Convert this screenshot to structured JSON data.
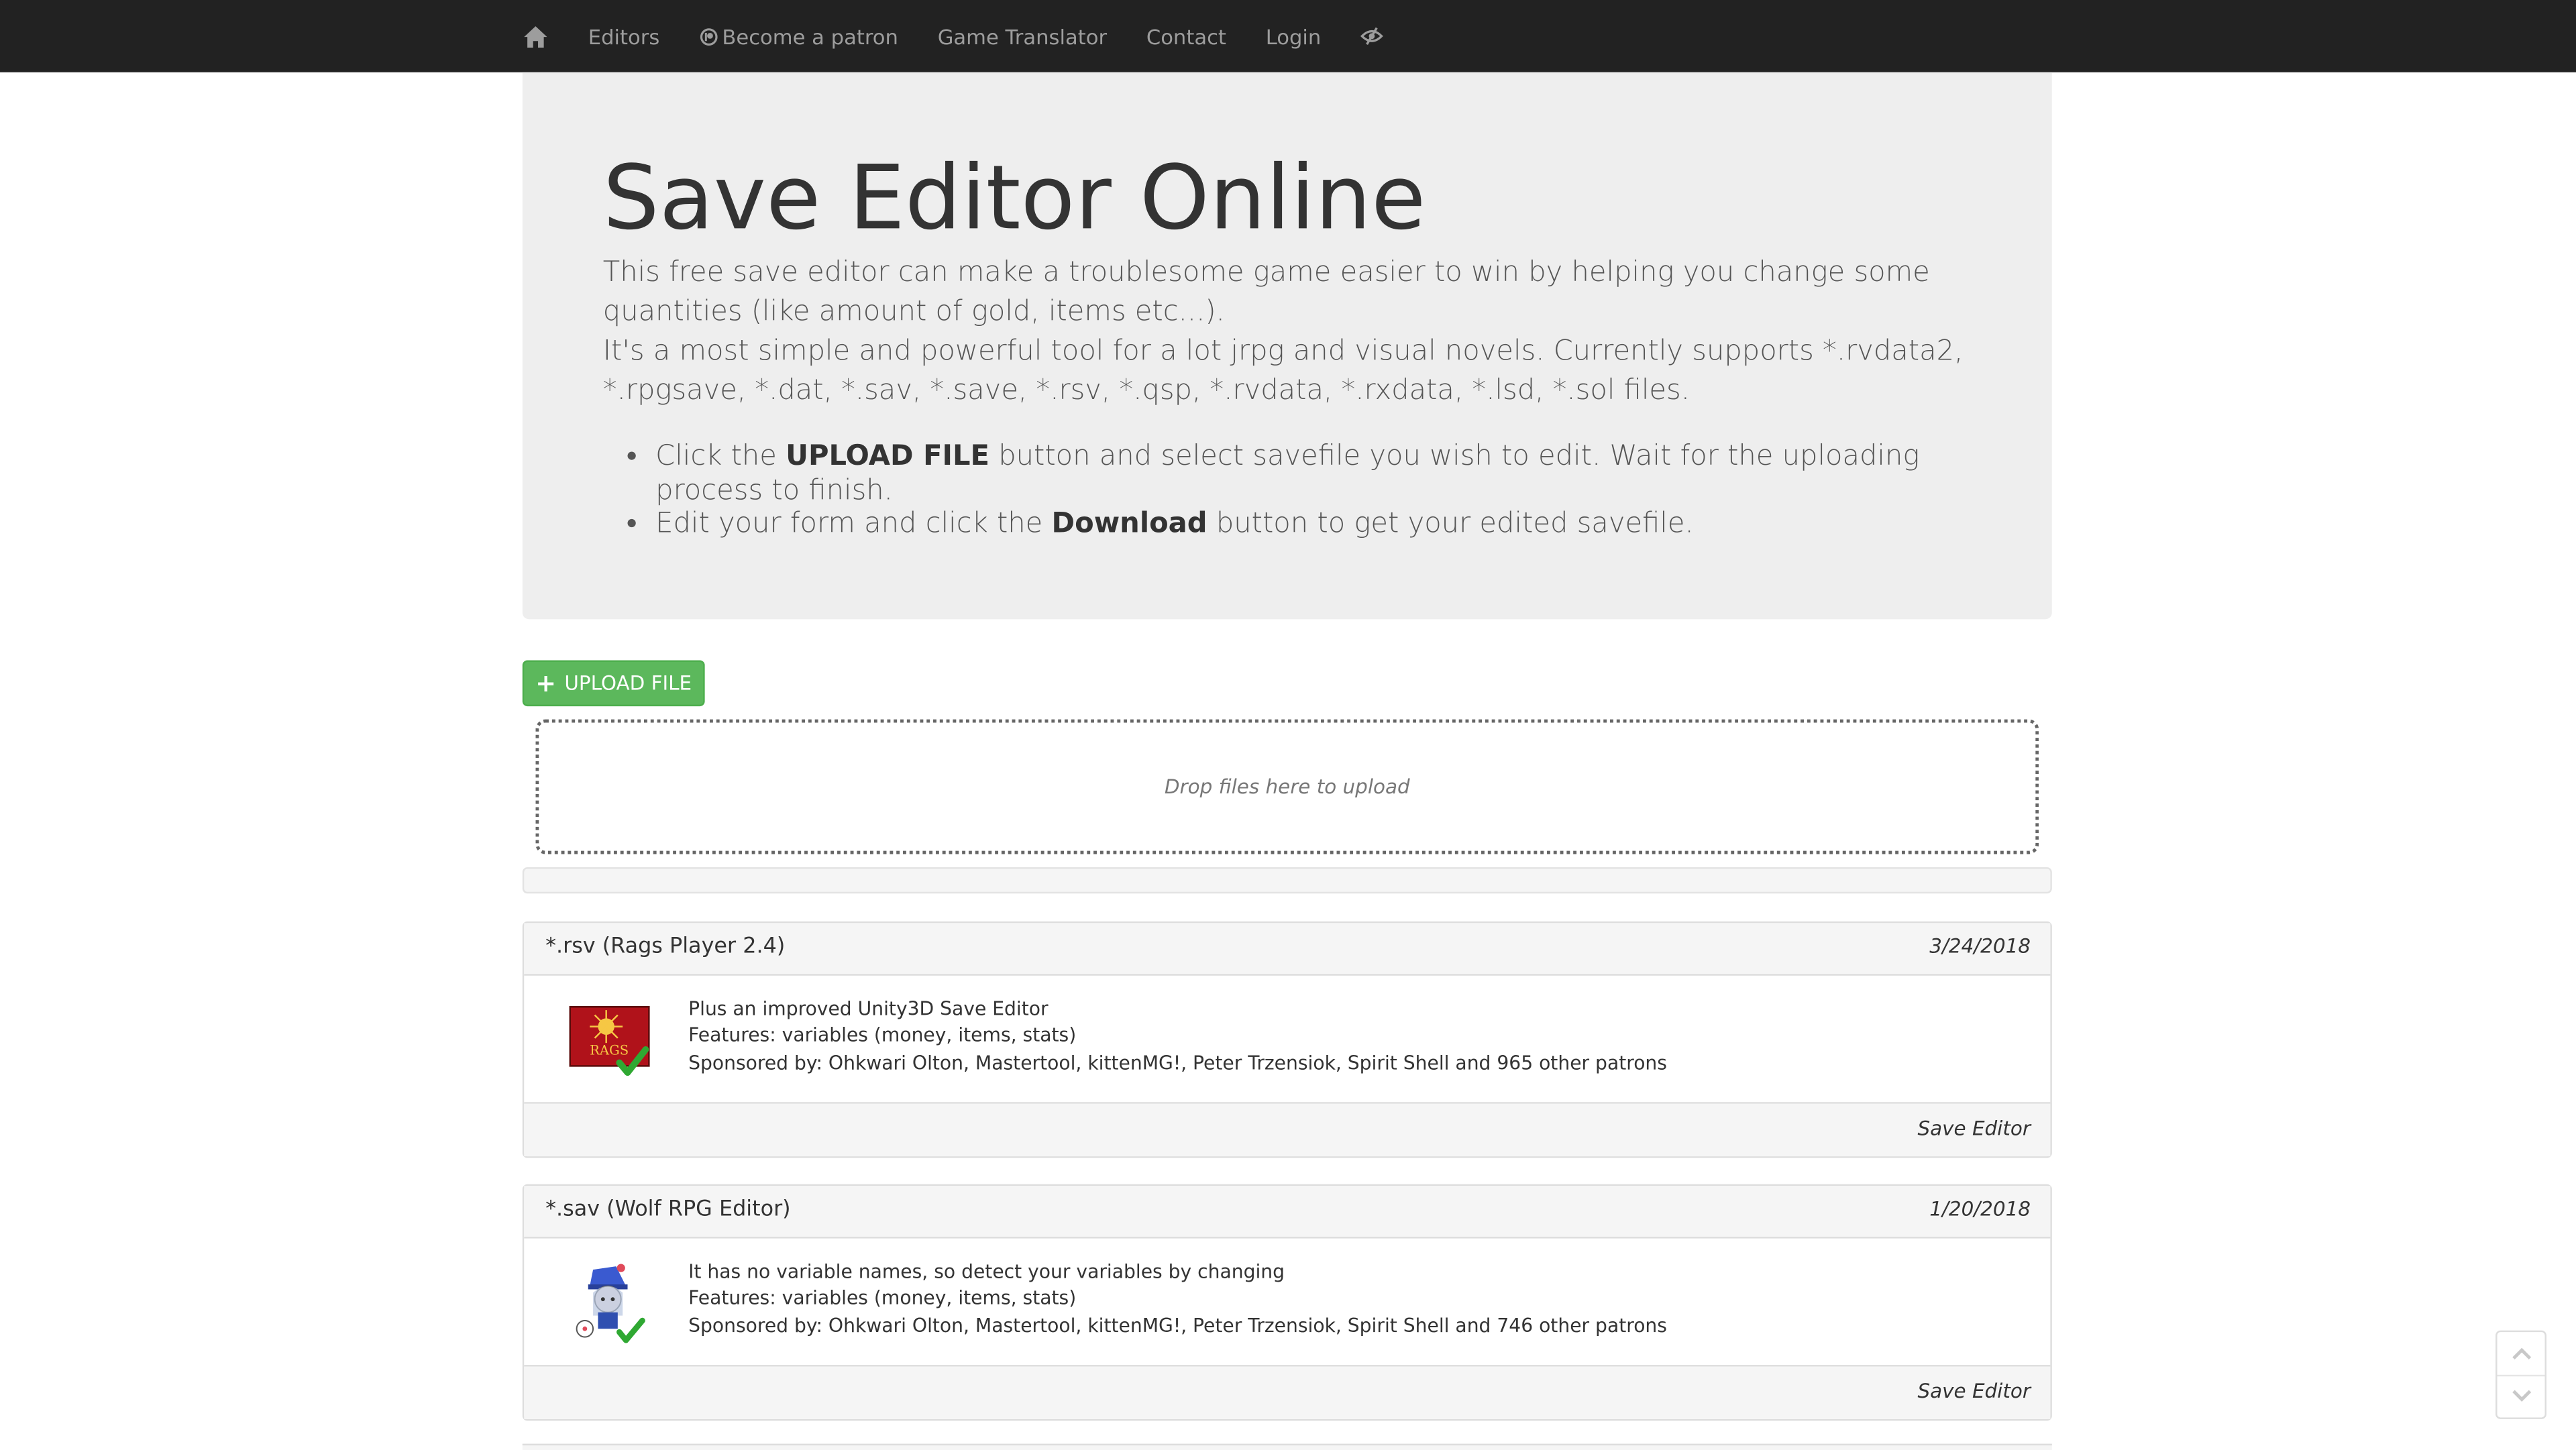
{
  "nav": {
    "home_icon": "home-icon",
    "items": [
      {
        "label": "Editors"
      },
      {
        "label": "Become a patron",
        "icon": "patreon-icon"
      },
      {
        "label": "Game Translator"
      },
      {
        "label": "Contact"
      },
      {
        "label": "Login"
      }
    ],
    "eye_icon": "eye-slash-icon"
  },
  "jumbotron": {
    "title": "Save Editor Online",
    "p1": "This free save editor can make a troublesome game easier to win by helping you change some quantities (like amount of gold, items etc...).",
    "p2": "It's a most simple and powerful tool for a lot jrpg and visual novels. Currently supports *.rvdata2, *.rpgsave, *.dat, *.sav, *.save, *.rsv, *.qsp, *.rvdata, *.rxdata, *.lsd, *.sol files.",
    "steps": [
      {
        "pre": "Click the ",
        "bold": "UPLOAD FILE",
        "post": " button and select savefile you wish to edit. Wait for the uploading process to finish."
      },
      {
        "pre": "Edit your form and click the ",
        "bold": "Download",
        "post": " button to get your edited savefile."
      }
    ]
  },
  "upload": {
    "button_label": "UPLOAD FILE",
    "dropzone_text": "Drop files here to upload"
  },
  "editors": [
    {
      "title": "*.rsv (Rags Player 2.4)",
      "date": "3/24/2018",
      "image": "rags-logo",
      "image_text": "RAGS",
      "line1": "Plus an improved Unity3D Save Editor",
      "line2": "Features: variables (money, items, stats)",
      "line3": "Sponsored by: Ohkwari Olton, Mastertool, kittenMG!, Peter Trzensiok, Spirit Shell and 965 other patrons",
      "link": "Save Editor"
    },
    {
      "title": "*.sav (Wolf RPG Editor)",
      "date": "1/20/2018",
      "image": "wolf-rpg-mascot",
      "line1": "It has no variable names, so detect your variables by changing",
      "line2": "Features: variables (money, items, stats)",
      "line3": "Sponsored by: Ohkwari Olton, Mastertool, kittenMG!, Peter Trzensiok, Spirit Shell and 746 other patrons",
      "link": "Save Editor"
    }
  ],
  "colors": {
    "navbar": "#222222",
    "nav_text": "#9d9d9d",
    "jumbotron": "#eeeeee",
    "upload_button": "#5cb85c",
    "panel_heading": "#f5f5f5"
  },
  "scroll": {
    "up_icon": "chevron-up-icon",
    "down_icon": "chevron-down-icon"
  }
}
